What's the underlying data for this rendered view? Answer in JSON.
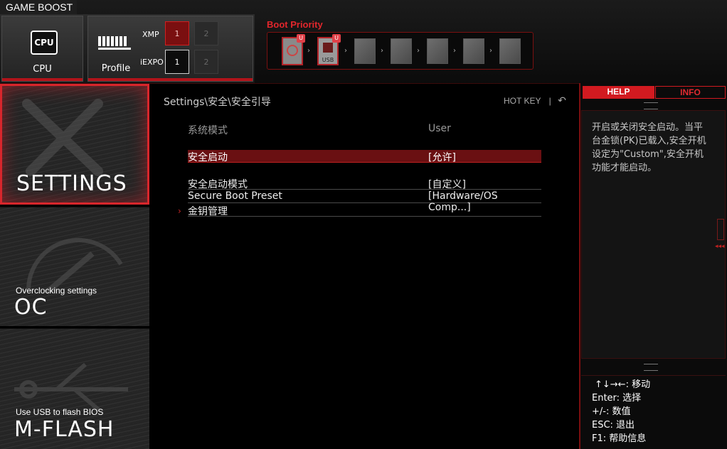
{
  "game_boost": {
    "label": "GAME BOOST"
  },
  "boost_options": {
    "cpu_label": "CPU",
    "cpu_chip_text": "CPU",
    "profile_label": "Profile",
    "xmp_label": "XMP",
    "iexpo_label": "iEXPO",
    "xmp_buttons": [
      "1",
      "2"
    ],
    "iexpo_buttons": [
      "1",
      "2"
    ]
  },
  "boot_priority": {
    "title": "Boot Priority",
    "usb_label": "USB",
    "badge": "U"
  },
  "nav": {
    "settings": {
      "title": "SETTINGS"
    },
    "oc": {
      "subtitle": "Overclocking settings",
      "title": "OC"
    },
    "mflash": {
      "subtitle": "Use USB to flash BIOS",
      "title": "M-FLASH"
    }
  },
  "main": {
    "breadcrumb": "Settings\\安全\\安全引导",
    "hotkey": "HOT KEY",
    "hotkey_sep": "|",
    "back_icon": "↶",
    "header": {
      "key": "系统模式",
      "value": "User"
    },
    "rows": [
      {
        "key": "安全启动",
        "value": "[允许]"
      },
      {
        "key": "安全启动模式",
        "value": "[自定义]"
      },
      {
        "key": "Secure Boot Preset",
        "value": "[Hardware/OS Comp...]"
      },
      {
        "key": "金钥管理",
        "value": ""
      }
    ],
    "submenu_marker": "›"
  },
  "help_panel": {
    "tab_help": "HELP",
    "tab_info": "INFO",
    "text": "开启或关闭安全启动。当平台金锁(PK)已载入,安全开机设定为\"Custom\",安全开机功能才能启动。",
    "keys": [
      "↑↓→←: 移动",
      "Enter: 选择",
      "+/-: 数值",
      "ESC: 退出",
      "F1: 帮助信息"
    ]
  },
  "colors": {
    "accent": "#d21a20",
    "selected_row": "#6a1012"
  }
}
